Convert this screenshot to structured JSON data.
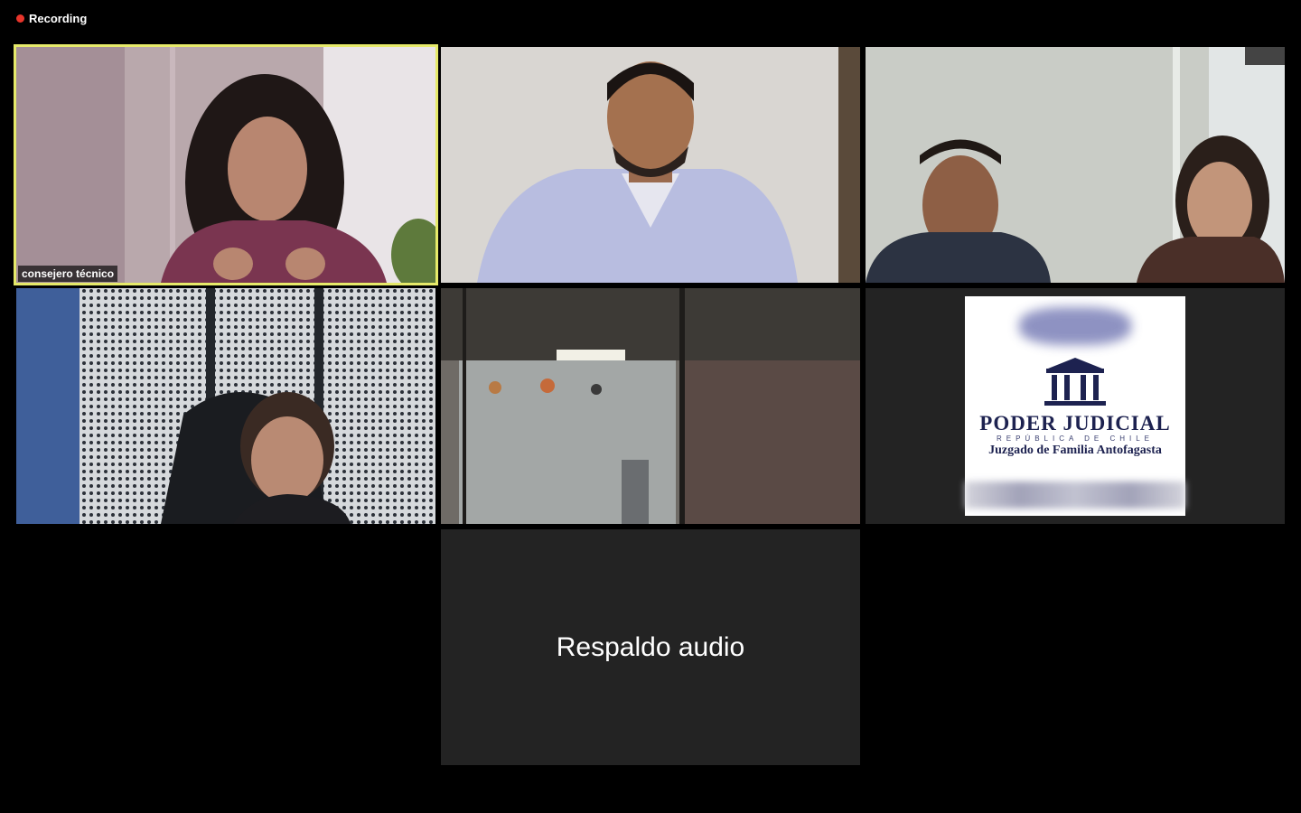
{
  "status": {
    "recording_label": "Recording",
    "recording_color": "#e8352b"
  },
  "participants": [
    {
      "name_label": "consejero técnico",
      "active_speaker": true,
      "highlight_color": "#e6ea6a"
    },
    {
      "name_label": ""
    },
    {
      "name_label": ""
    },
    {
      "name_label": ""
    },
    {
      "name_label": ""
    },
    {
      "name_label": ""
    },
    {
      "display_name": "Respaldo audio"
    }
  ],
  "logo": {
    "line1": "PODER JUDICIAL",
    "line2": "REPÚBLICA DE CHILE",
    "line3": "Juzgado de Familia Antofagasta"
  }
}
